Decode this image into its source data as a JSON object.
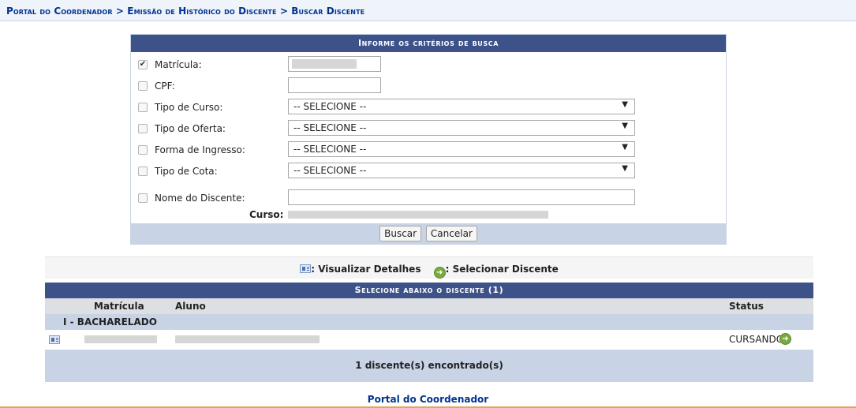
{
  "breadcrumb": {
    "text": "Portal do Coordenador > Emissão de Histórico do Discente > Buscar Discente"
  },
  "form": {
    "caption": "Informe os critérios de busca",
    "fields": {
      "matricula": {
        "label": "Matrícula:",
        "checked": true
      },
      "cpf": {
        "label": "CPF:",
        "checked": false
      },
      "tipo_curso": {
        "label": "Tipo de Curso:",
        "checked": false,
        "selected": "-- SELECIONE --"
      },
      "tipo_oferta": {
        "label": "Tipo de Oferta:",
        "checked": false,
        "selected": "-- SELECIONE --"
      },
      "forma_ingresso": {
        "label": "Forma de Ingresso:",
        "checked": false,
        "selected": "-- SELECIONE --"
      },
      "tipo_cota": {
        "label": "Tipo de Cota:",
        "checked": false,
        "selected": "-- SELECIONE --"
      },
      "nome_discente": {
        "label": "Nome do Discente:",
        "checked": false
      }
    },
    "curso_label": "Curso:",
    "buttons": {
      "search": "Buscar",
      "cancel": "Cancelar"
    }
  },
  "legend": {
    "details": ": Visualizar Detalhes",
    "select": ": Selecionar Discente"
  },
  "results": {
    "caption": "Selecione abaixo o discente (1)",
    "columns": {
      "matricula": "Matrícula",
      "aluno": "Aluno",
      "status": "Status"
    },
    "group": "I - BACHARELADO",
    "rows": [
      {
        "status": "CURSANDO"
      }
    ],
    "footer": "1 discente(s) encontrado(s)"
  },
  "footer_link": "Portal do Coordenador",
  "colors": {
    "header_bar": "#3d5289",
    "light_blue": "#c8d3e6",
    "link": "#003390",
    "accent_line": "#e0a75a",
    "go_icon": "#7aaa3f"
  }
}
